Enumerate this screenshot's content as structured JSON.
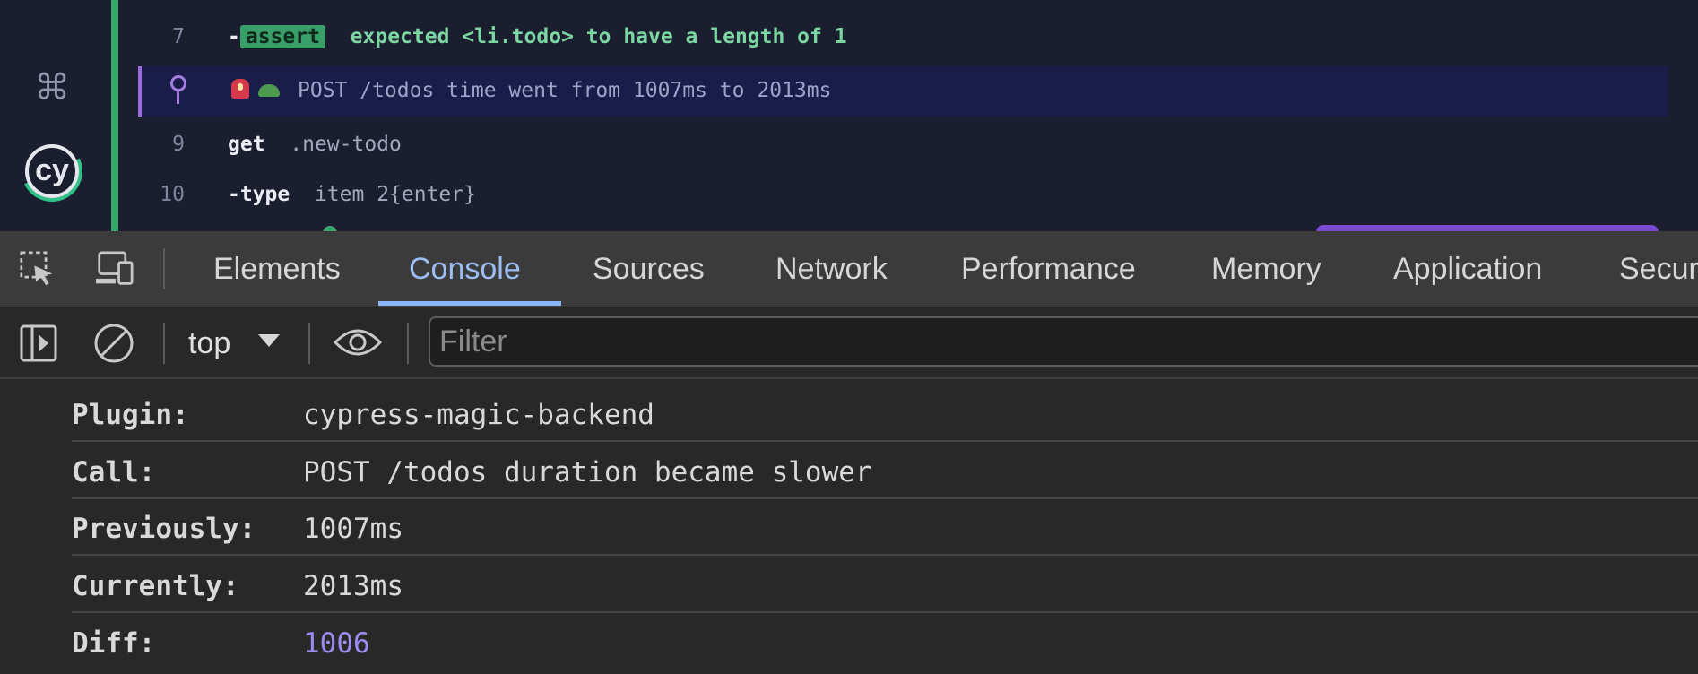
{
  "cypress": {
    "rows": [
      {
        "num": "7",
        "prefix": "-",
        "badge": "assert",
        "text_parts": [
          "expected",
          "<li.todo>",
          "to have a length of",
          "1"
        ]
      },
      {
        "num": "",
        "message": "POST /todos time went from 1007ms to 2013ms"
      },
      {
        "num": "9",
        "command": "get",
        "arg": ".new-todo"
      },
      {
        "num": "10",
        "command": "-type",
        "arg": "item 2{enter}"
      }
    ]
  },
  "devtools": {
    "tabs": [
      "Elements",
      "Console",
      "Sources",
      "Network",
      "Performance",
      "Memory",
      "Application",
      "Secur"
    ],
    "active_tab": "Console",
    "context": "top",
    "filter_placeholder": "Filter"
  },
  "console": {
    "rows": [
      {
        "key": "Plugin:",
        "value": "cypress-magic-backend"
      },
      {
        "key": "Call:",
        "value": "POST /todos duration became slower"
      },
      {
        "key": "Previously:",
        "value": "1007ms"
      },
      {
        "key": "Currently:",
        "value": "2013ms"
      },
      {
        "key": "Diff:",
        "value": "1006"
      }
    ]
  },
  "colors": {
    "accent_tab": "#9cbdf2",
    "diff_number": "#9a8cf2",
    "assert_badge": "#3a9e68",
    "highlight_row": "#1a1c4a"
  }
}
